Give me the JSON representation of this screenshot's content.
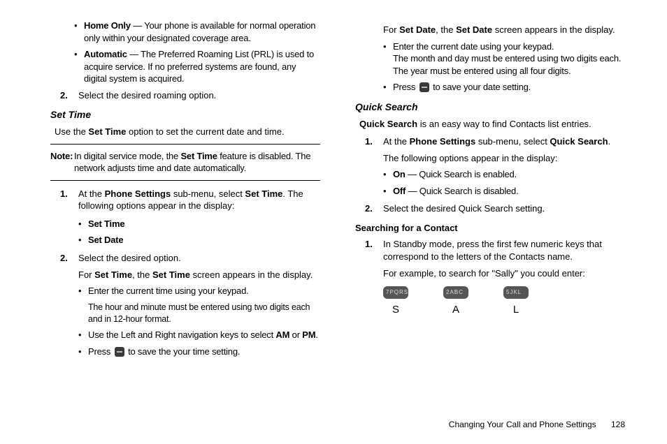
{
  "col1": {
    "roaming": {
      "home_only_label": "Home Only",
      "home_only_text": " — Your phone is available for normal operation only within your designated coverage area.",
      "automatic_label": "Automatic",
      "automatic_text": " — The Preferred Roaming List (PRL) is used to acquire service. If no preferred systems are found, any digital system is acquired."
    },
    "step2": "Select the desired roaming option.",
    "set_time_heading": "Set Time",
    "set_time_intro_pre": "Use the ",
    "set_time_intro_b": "Set Time",
    "set_time_intro_post": " option to set the current date and time.",
    "note_label": "Note:",
    "note_text_pre": " In digital service mode, the ",
    "note_text_b": "Set Time",
    "note_text_post": " feature is disabled. The network adjusts time and date automatically.",
    "st1_pre": "At the ",
    "st1_b1": "Phone Settings",
    "st1_mid": " sub-menu, select ",
    "st1_b2": "Set Time",
    "st1_post": ". The following options appear in the display:",
    "opt_set_time": "Set Time",
    "opt_set_date": "Set Date",
    "st2": "Select the desired option.",
    "for_st_pre": "For ",
    "for_st_b1": "Set Time",
    "for_st_mid": ", the ",
    "for_st_b2": "Set Time",
    "for_st_post": " screen appears in the display.",
    "st_b1": "Enter the current time using your keypad.",
    "st_b1_sub": "The hour and minute must be entered using two digits each and in 12-hour format.",
    "st_b2_pre": "Use the Left and Right navigation keys to select ",
    "st_b2_am": "AM",
    "st_b2_mid": " or ",
    "st_b2_pm": "PM",
    "st_b2_post": ".",
    "st_b3_pre": "Press ",
    "st_b3_post": " to save the your time setting."
  },
  "col2": {
    "for_sd_pre": "For ",
    "for_sd_b1": "Set Date",
    "for_sd_mid": ", the ",
    "for_sd_b2": "Set Date",
    "for_sd_post": " screen appears in the display.",
    "sd_b1": "Enter the current date using your keypad.",
    "sd_b1_sub": "The month and day must be entered using two digits each. The year must be entered using all four digits.",
    "sd_b2_pre": "Press ",
    "sd_b2_post": " to save your date setting.",
    "qs_heading": "Quick Search",
    "qs_intro_b": "Quick Search",
    "qs_intro_post": " is an easy way to find Contacts list entries.",
    "qs1_pre": "At the ",
    "qs1_b1": "Phone Settings",
    "qs1_mid": " sub-menu, select ",
    "qs1_b2": "Quick Search",
    "qs1_post": ".",
    "qs1_sub": "The following options appear in the display:",
    "qs_on_b": "On",
    "qs_on_post": " — Quick Search is enabled.",
    "qs_off_b": "Off",
    "qs_off_post": " — Quick Search is disabled.",
    "qs2": "Select the desired Quick Search setting.",
    "sfc_heading": "Searching for a Contact",
    "sfc1": "In Standby mode, press the first few numeric keys that correspond to the letters of the Contacts name.",
    "sfc1_sub": "For example, to search for \"Sally\" you could enter:",
    "keys": [
      {
        "cap": "7PQRS",
        "label": "S"
      },
      {
        "cap": "2ABC",
        "label": "A"
      },
      {
        "cap": "5JKL",
        "label": "L"
      }
    ]
  },
  "footer": {
    "section": "Changing Your Call and Phone Settings",
    "page": "128"
  }
}
